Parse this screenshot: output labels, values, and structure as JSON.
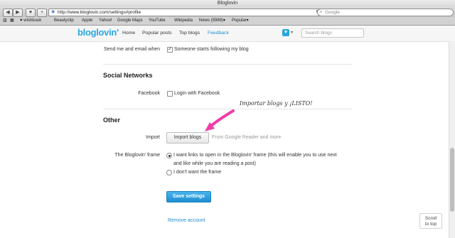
{
  "window": {
    "title": "Bloglovin"
  },
  "toolbar": {
    "back": "◀",
    "forward": "▶",
    "add": "+",
    "url": "http://www.bloglovin.com/settings#profile",
    "search_placeholder": "Google"
  },
  "bookmarks": [
    "♥ wishbuuk",
    "Beautyclip",
    "Apple",
    "Yahoo!",
    "Google Maps",
    "YouTube",
    "Wikipedia",
    "News (5989)▾",
    "Popular▾"
  ],
  "header": {
    "logo": "bloglovin'",
    "nav": [
      "Home",
      "Popular posts",
      "Top blogs",
      "Feedback"
    ],
    "search_placeholder": "Search blogs"
  },
  "email_row": {
    "label": "Send me and email when",
    "option": "Someone starts following my blog",
    "checked": true
  },
  "social": {
    "title": "Social Networks",
    "facebook_label": "Facebook",
    "facebook_option": "Login with Facebook"
  },
  "other": {
    "title": "Other",
    "import_label": "Import",
    "import_button": "Import blogs",
    "import_hint": "From Google Reader and more",
    "frame_label": "The Bloglovin' frame",
    "frame_option1_line1": "I want links to open in the Bloglovin' frame (this will enable you to use next",
    "frame_option1_line2": "and like while you are reading a post)",
    "frame_option2": "I don't want the frame"
  },
  "annotation": "Importar blogs y ¡LISTO!",
  "actions": {
    "save": "Save settings",
    "remove": "Remove account"
  },
  "scroll_to_top": [
    "Scroll",
    "to top"
  ],
  "colors": {
    "brand": "#2aa7e0",
    "annotation_arrow": "#f03ca8"
  }
}
